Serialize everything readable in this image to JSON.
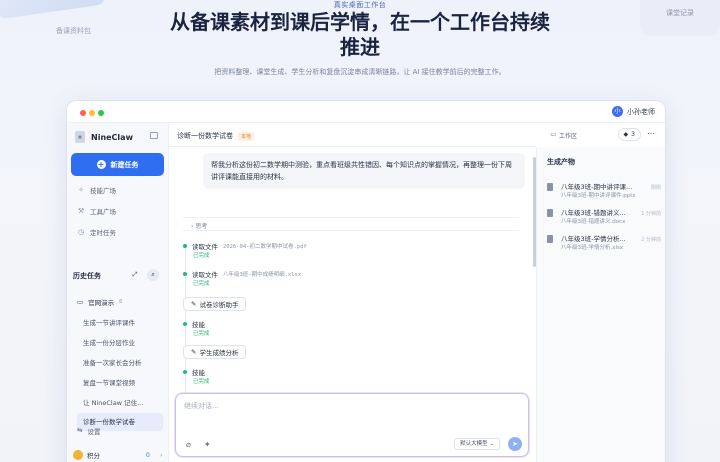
{
  "decor": {
    "left_text": "备课资料包",
    "right_text": "课堂记录"
  },
  "hero": {
    "tag": "真实桌面工作台",
    "title": "从备课素材到课后学情，在一个工作台持续推进",
    "subtitle": "把资料整理、课堂生成、学生分析和复盘沉淀串成清晰链路，让 AI 接住教学前后的完整工作。"
  },
  "user": {
    "avatar_initial": "小",
    "name": "小孙老师"
  },
  "sidebar": {
    "brand": "NineClaw",
    "new_task": "新建任务",
    "nav": [
      {
        "label": "技能广场",
        "icon": "sparkle-icon"
      },
      {
        "label": "工具广场",
        "icon": "tool-icon"
      },
      {
        "label": "定时任务",
        "icon": "clock-icon"
      }
    ],
    "history_title": "历史任务",
    "group": {
      "name": "官网演示",
      "count": "6"
    },
    "history": [
      "生成一节讲评课件",
      "生成一份分层作业",
      "准备一次家长会分析",
      "复盘一节课堂视频",
      "让 NineClaw 记住...",
      "诊断一份数学试卷"
    ],
    "settings": "设置",
    "points": {
      "label": "积分",
      "value": "0"
    }
  },
  "main": {
    "task_title": "诊断一份数学试卷",
    "task_badge": "本地",
    "workspace": "工作区",
    "count": "3",
    "user_message": "帮我分析这份初二数学期中测验，重点看班级共性错因、每个知识点的掌握情况，再整理一份下周讲评课能直接用的材料。",
    "think_label": "思考",
    "steps": [
      {
        "title": "读取文件",
        "detail": "2026-04-初二数学期中试卷.pdf",
        "status": "已完成"
      },
      {
        "title": "读取文件",
        "detail": "八年级3班-期中成绩明细.xlsx",
        "status": "已完成"
      }
    ],
    "skill1": "试卷诊断助手",
    "skill1_step": {
      "title": "技能",
      "status": "已完成"
    },
    "skill2": "学生成绩分析",
    "skill2_step": {
      "title": "技能",
      "status": "已完成"
    },
    "composer_placeholder": "继续对话...",
    "model": "默认大模型"
  },
  "outputs": {
    "title": "生成产物",
    "files": [
      {
        "name": "八年级3班-期中讲评课...",
        "meta": "八年级3班-期中讲评课件.pptx",
        "time": "刚刚"
      },
      {
        "name": "八年级3班-错题讲义...",
        "meta": "八年级3班-错题讲义.docx",
        "time": "1 分钟前"
      },
      {
        "name": "八年级3班-学情分析...",
        "meta": "八年级3班-学情分析.xlsx",
        "time": "2 分钟前"
      }
    ]
  },
  "colors": {
    "accent": "#2f6ef0",
    "success": "#2bb673",
    "badge": "#d9822b"
  }
}
